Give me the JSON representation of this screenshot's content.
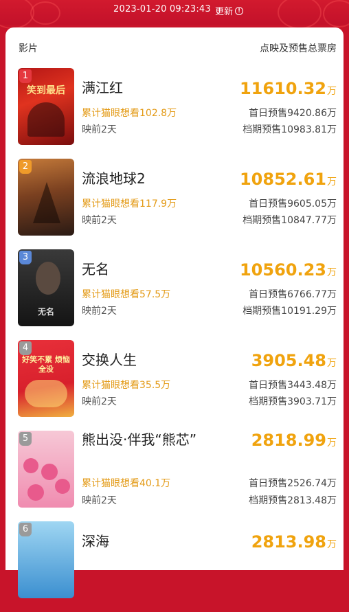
{
  "status": {
    "datetime": "2023-01-20  09:23:43",
    "refresh_label": "更新"
  },
  "table": {
    "col_film": "影片",
    "col_box": "点映及预售总票房"
  },
  "colors": {
    "accent": "#f0a30e",
    "want": "#e39a16",
    "bg_red": "#c8142a"
  },
  "movies": [
    {
      "rank": "1",
      "title": "满江红",
      "want": "累计猫眼想看102.8万",
      "days": "映前2天",
      "total": "11610.32",
      "unit": "万",
      "first_day": "首日预售9420.86万",
      "period": "档期预售10983.81万",
      "badge_color": "#e5383f",
      "poster_text": "笑到最后"
    },
    {
      "rank": "2",
      "title": "流浪地球2",
      "want": "累计猫眼想看117.9万",
      "days": "映前2天",
      "total": "10852.61",
      "unit": "万",
      "first_day": "首日预售9605.05万",
      "period": "档期预售10847.77万",
      "badge_color": "#ef9b2a",
      "poster_text": ""
    },
    {
      "rank": "3",
      "title": "无名",
      "want": "累计猫眼想看57.5万",
      "days": "映前2天",
      "total": "10560.23",
      "unit": "万",
      "first_day": "首日预售6766.77万",
      "period": "档期预售10191.29万",
      "badge_color": "#5a88d8",
      "poster_text": "无名"
    },
    {
      "rank": "4",
      "title": "交换人生",
      "want": "累计猫眼想看35.5万",
      "days": "映前2天",
      "total": "3905.48",
      "unit": "万",
      "first_day": "首日预售3443.48万",
      "period": "档期预售3903.71万",
      "badge_color": "#9a9a9a",
      "poster_text": "好笑不累 烦恼全没"
    },
    {
      "rank": "5",
      "title": "熊出没·伴我“熊芯”",
      "want": "累计猫眼想看40.1万",
      "days": "映前2天",
      "total": "2818.99",
      "unit": "万",
      "first_day": "首日预售2526.74万",
      "period": "档期预售2813.48万",
      "badge_color": "#9a9a9a",
      "poster_text": ""
    },
    {
      "rank": "6",
      "title": "深海",
      "want": "",
      "days": "",
      "total": "2813.98",
      "unit": "万",
      "first_day": "",
      "period": "",
      "badge_color": "#9a9a9a",
      "poster_text": ""
    }
  ]
}
